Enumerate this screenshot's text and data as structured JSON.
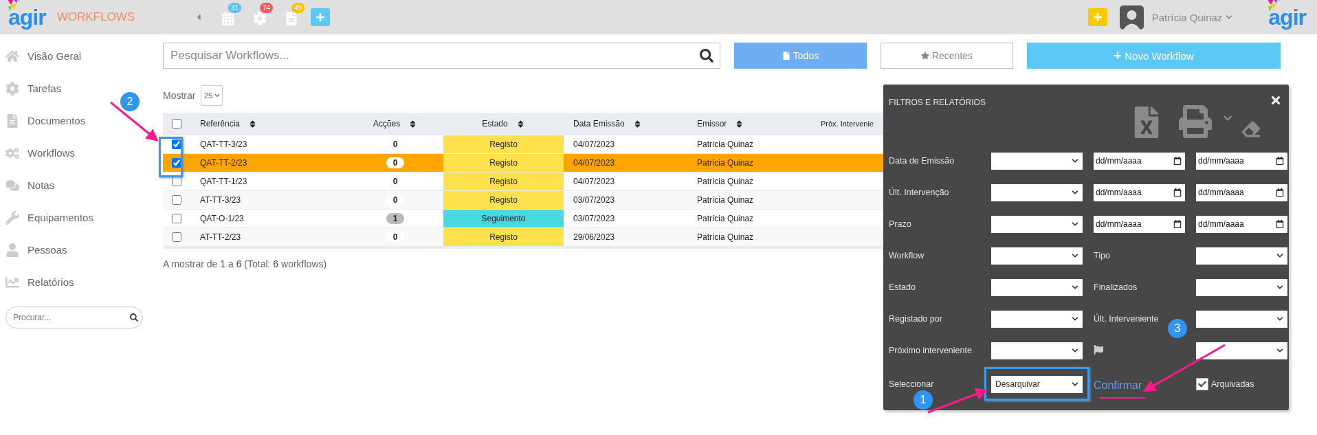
{
  "topbar": {
    "logo": "agir",
    "section": "WORKFLOWS",
    "counters": [
      {
        "kind": "calendar",
        "count": "31",
        "color": "#5bc0f5"
      },
      {
        "kind": "gear",
        "count": "74",
        "color": "#f25c5c"
      },
      {
        "kind": "document",
        "count": "49",
        "color": "#f5c400"
      }
    ],
    "user": "Patrícia Quinaz",
    "logo_right": "agir"
  },
  "sidebar": {
    "items": [
      {
        "kind": "home",
        "label": "Visão Geral"
      },
      {
        "kind": "gear",
        "label": "Tarefas"
      },
      {
        "kind": "document",
        "label": "Documentos"
      },
      {
        "kind": "gears",
        "label": "Workflows"
      },
      {
        "kind": "comments",
        "label": "Notas"
      },
      {
        "kind": "wrench",
        "label": "Equipamentos"
      },
      {
        "kind": "user",
        "label": "Pessoas"
      },
      {
        "kind": "chart",
        "label": "Relatórios"
      }
    ],
    "search": {
      "placeholder": "Procurar..."
    }
  },
  "search": {
    "placeholder": "Pesquisar Workflows..."
  },
  "filters": [
    {
      "kind": "file",
      "label": "Todos",
      "selected": true
    },
    {
      "kind": "star",
      "label": "Recentes",
      "selected": false
    }
  ],
  "new_button": "Novo Workflow",
  "page_size": {
    "label": "Mostrar",
    "value": "25"
  },
  "table": {
    "select_all": false,
    "columns": [
      "Referência",
      "Acções",
      "Estado",
      "Data Emissão",
      "Emissor",
      "Próx. Intervenie"
    ],
    "rows": [
      {
        "checked": true,
        "selected": false,
        "ref": "QAT-TT-3/23",
        "actions": "0",
        "highlighted": false,
        "status": "Registo",
        "color": "#ffe14d",
        "date": "04/07/2023",
        "issuer": "Patrícia Quinaz"
      },
      {
        "checked": true,
        "selected": true,
        "ref": "QAT-TT-2/23",
        "actions": "0",
        "highlighted": false,
        "status": "Registo",
        "color": "#ffe14d",
        "date": "04/07/2023",
        "issuer": "Patrícia Quinaz"
      },
      {
        "checked": false,
        "selected": false,
        "ref": "QAT-TT-1/23",
        "actions": "0",
        "highlighted": false,
        "status": "Registo",
        "color": "#ffe14d",
        "date": "04/07/2023",
        "issuer": "Patrícia Quinaz"
      },
      {
        "checked": false,
        "selected": false,
        "ref": "AT-TT-3/23",
        "actions": "0",
        "highlighted": false,
        "status": "Registo",
        "color": "#ffe14d",
        "date": "03/07/2023",
        "issuer": "Patrícia Quinaz"
      },
      {
        "checked": false,
        "selected": false,
        "ref": "QAT-O-1/23",
        "actions": "1",
        "highlighted": true,
        "status": "Seguimento",
        "color": "#48d8e0",
        "date": "03/07/2023",
        "issuer": "Patrícia Quinaz"
      },
      {
        "checked": false,
        "selected": false,
        "ref": "AT-TT-2/23",
        "actions": "0",
        "highlighted": false,
        "status": "Registo",
        "color": "#ffe14d",
        "date": "29/06/2023",
        "issuer": "Patrícia Quinaz"
      }
    ],
    "footer": "A mostrar de **1** a **6** (Total: **6** workflows)"
  },
  "panel": {
    "title": "FILTROS E RELATÓRIOS",
    "rows": [
      {
        "kind": "date_range",
        "label": "Data de Emissão",
        "dates": [
          {
            "placeholder": "dd/mm/aaaa"
          },
          {
            "placeholder": "dd/mm/aaaa"
          }
        ]
      },
      {
        "kind": "date_range",
        "label": "Últ. Intervenção",
        "dates": [
          {
            "placeholder": "dd/mm/aaaa"
          },
          {
            "placeholder": "dd/mm/aaaa"
          }
        ]
      },
      {
        "kind": "date_range",
        "label": "Prazo",
        "dates": [
          {
            "placeholder": "dd/mm/aaaa"
          },
          {
            "placeholder": "dd/mm/aaaa"
          }
        ]
      },
      {
        "kind": "pair",
        "label": "Workflow",
        "label_2": "Tipo"
      },
      {
        "kind": "pair",
        "label": "Estado",
        "label_2": "Finalizados"
      },
      {
        "kind": "pair",
        "label": "Registado por",
        "label_2": "Últ. Interveniente"
      },
      {
        "kind": "flag_pair",
        "label": "Próximo interveniente"
      },
      {
        "kind": "action",
        "label": "Seleccionar",
        "value": "Desarquivar",
        "link": "Confirmar",
        "checkbox_label": "Arquivadas",
        "checked": true
      }
    ]
  },
  "annotations": [
    {
      "number": "1"
    },
    {
      "number": "2"
    },
    {
      "number": "3"
    }
  ]
}
